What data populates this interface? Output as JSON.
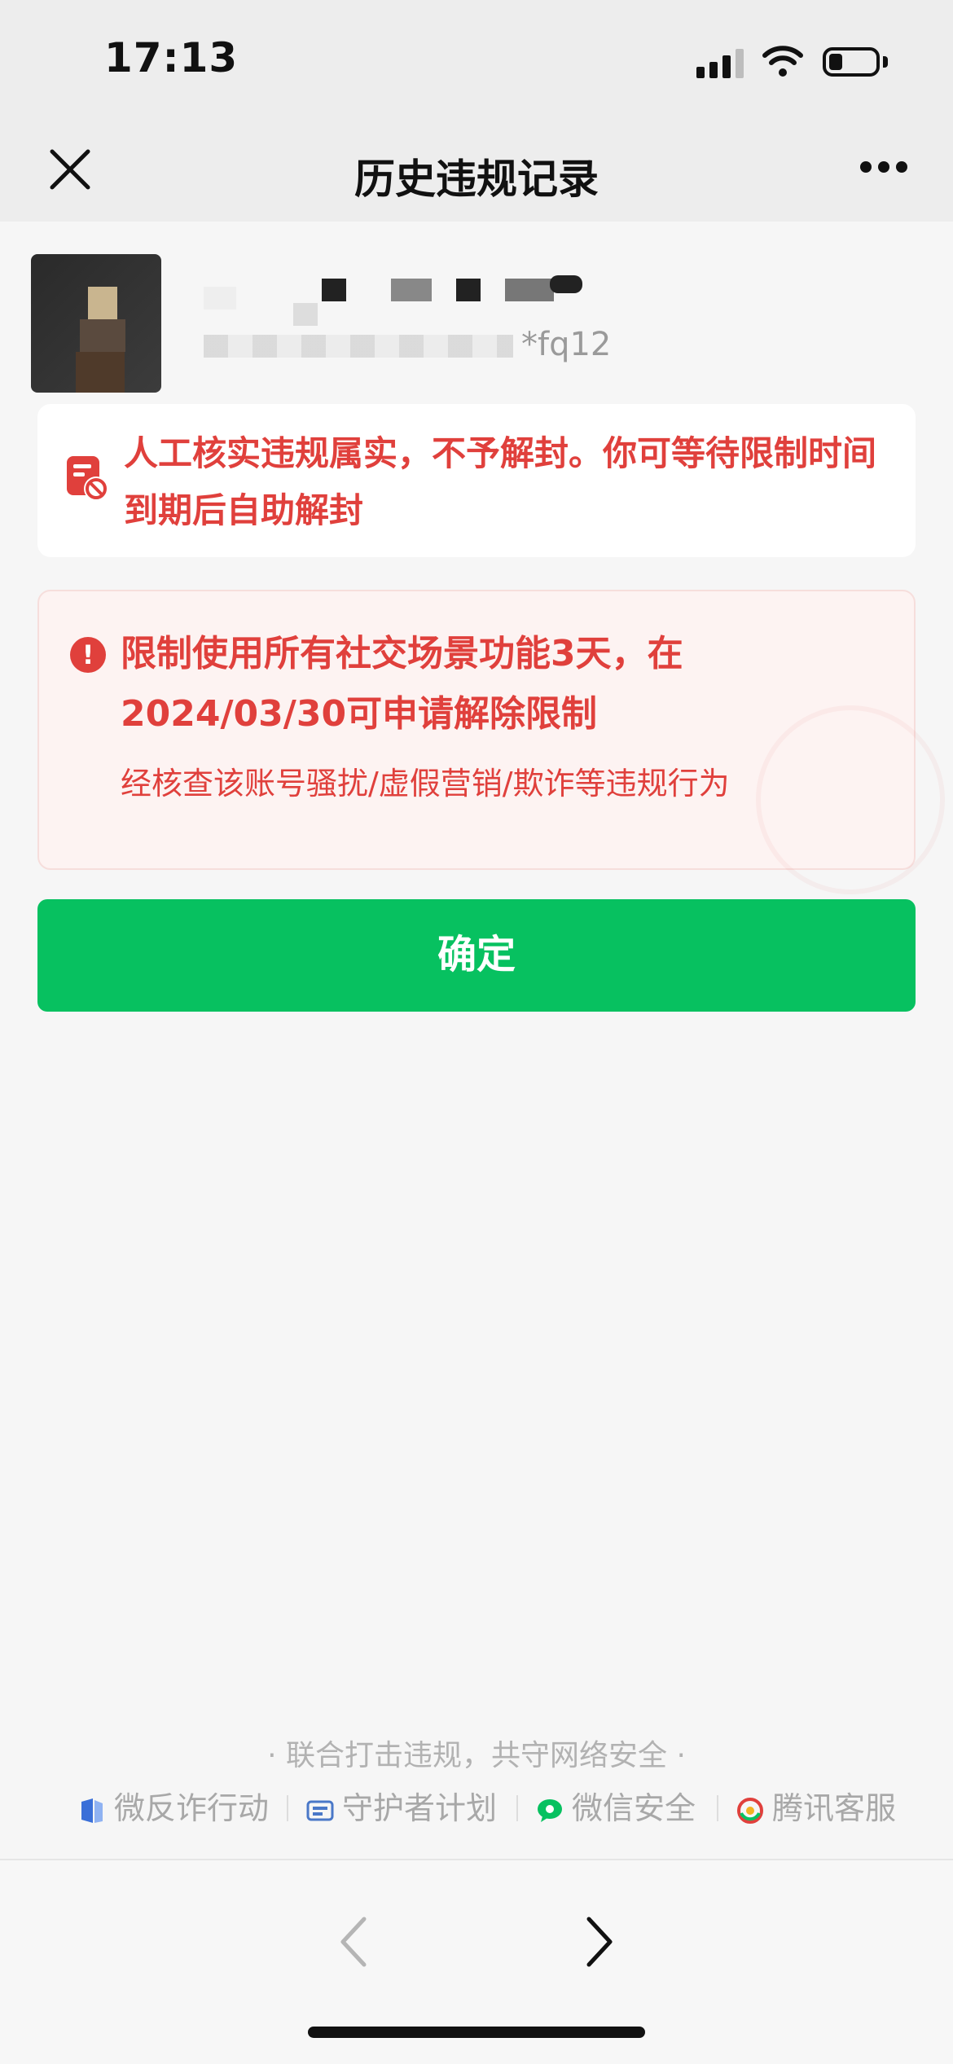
{
  "status_bar": {
    "time": "17:13",
    "battery_level": 0.25
  },
  "nav": {
    "title": "历史违规记录",
    "close_icon": "close-icon",
    "more_icon": "more-icon"
  },
  "profile": {
    "account_suffix": "*fq12"
  },
  "notice": {
    "text": "人工核实违规属实，不予解封。你可等待限制时间到期后自助解封",
    "icon": "document-block-icon",
    "color": "#e0403c"
  },
  "restriction": {
    "title": "限制使用所有社交场景功能3天，在2024/03/30可申请解除限制",
    "detail": "经核查该账号骚扰/虚假营销/欺诈等违规行为",
    "icon": "alert-icon"
  },
  "confirm_button": {
    "label": "确定",
    "color": "#07c160"
  },
  "footer": {
    "slogan": "· 联合打击违规，共守网络安全 ·",
    "links": [
      "微反诈行动",
      "守护者计划",
      "微信安全",
      "腾讯客服"
    ]
  },
  "bottom_nav": {
    "back_icon": "chevron-left-icon",
    "forward_icon": "chevron-right-icon"
  }
}
